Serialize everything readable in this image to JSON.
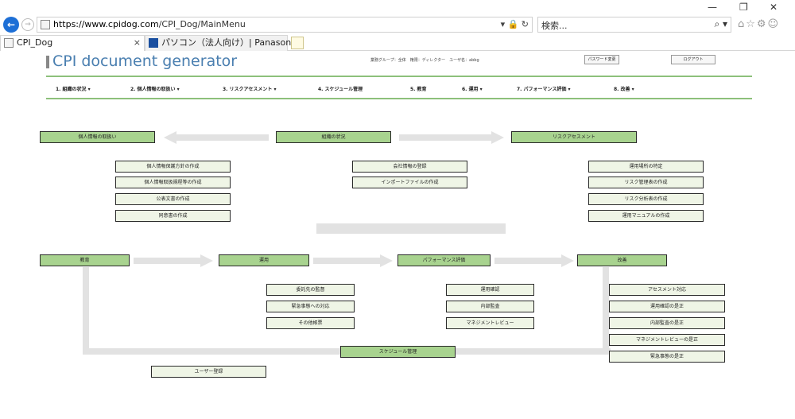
{
  "browser": {
    "url_host": "https://www.cpidog.com",
    "url_path": "/CPI_Dog/MainMenu",
    "url_icons": "▾ 🔒 ↻",
    "search_placeholder": "検索...",
    "search_icon": "⌕ ▾",
    "tabs": [
      {
        "label": "CPI_Dog",
        "close": "×"
      },
      {
        "label": "パソコン（法人向け）| Panasonic"
      }
    ],
    "window_controls": {
      "minimize": "—",
      "maximize": "❐",
      "close": "✕"
    },
    "toolbar_icons": "⌂☆⚙☺"
  },
  "header": {
    "brand": "CPI document generator",
    "user_info": "業務グループ：全体　権限：ディレクター　ユーザ名：abbg",
    "password_button": "パスワード変更",
    "logout_button": "ログアウト"
  },
  "menu": [
    "1. 組織の状況 ▾",
    "2. 個人情報の取扱い ▾",
    "3. リスクアセスメント ▾",
    "4. スケジュール管理",
    "5. 教育",
    "6. 運用 ▾",
    "7. パフォーマンス評価 ▾",
    "8. 改善 ▾"
  ],
  "diagram": {
    "top_nodes": {
      "personal_info": "個人情報の取扱い",
      "organization": "組織の状況",
      "risk": "リスクアセスメント"
    },
    "personal_info_items": [
      "個人情報保護方針の作成",
      "個人情報取扱規程等の作成",
      "公表文書の作成",
      "同意書の作成"
    ],
    "organization_items": [
      "会社情報の登録",
      "インポートファイルの作成"
    ],
    "risk_items": [
      "運用場所の特定",
      "リスク管理表の作成",
      "リスク分析表の作成",
      "運用マニュアルの作成"
    ],
    "bottom_nodes": {
      "education": "教育",
      "operation": "運用",
      "performance": "パフォーマンス評価",
      "improvement": "改善"
    },
    "operation_items": [
      "委託先の監督",
      "緊急事態への対応",
      "その他帳票"
    ],
    "performance_items": [
      "運用確認",
      "内部監査",
      "マネジメントレビュー"
    ],
    "improvement_items": [
      "アセスメント対応",
      "運用確認の是正",
      "内部監査の是正",
      "マネジメントレビューの是正",
      "緊急事態の是正"
    ],
    "schedule": "スケジュール管理",
    "user_register": "ユーザー登録"
  }
}
